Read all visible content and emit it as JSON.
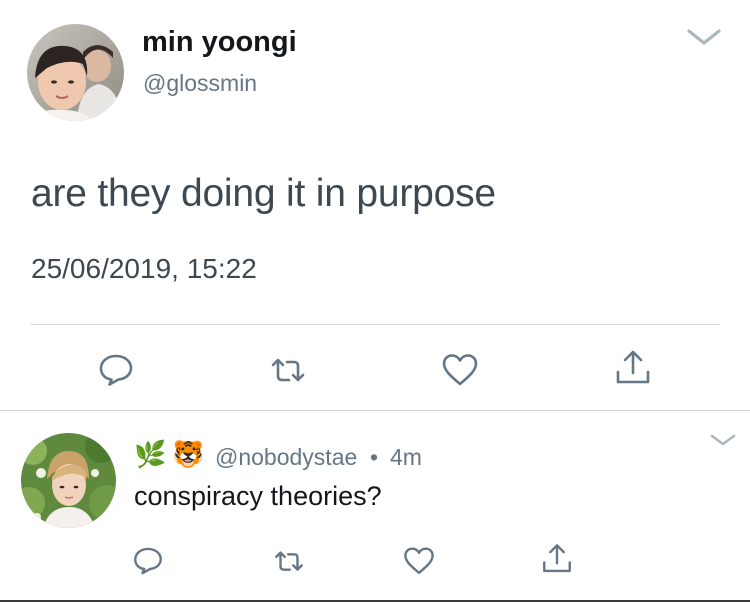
{
  "tweet": {
    "display_name": "min yoongi",
    "handle": "@glossmin",
    "text": "are they doing it in purpose",
    "timestamp": "25/06/2019, 15:22",
    "menu_icon": "chevron-down-icon"
  },
  "actions": [
    "reply-icon",
    "retweet-icon",
    "like-icon",
    "share-icon"
  ],
  "reply": {
    "emojis": [
      "🌿",
      "🐯"
    ],
    "handle": "@nobodystae",
    "separator": "•",
    "time": "4m",
    "text": "conspiracy theories?",
    "menu_icon": "chevron-down-icon"
  },
  "colors": {
    "text_primary": "#14171a",
    "text_secondary": "#657786",
    "icon": "#657786",
    "divider": "#d6dbe0"
  }
}
